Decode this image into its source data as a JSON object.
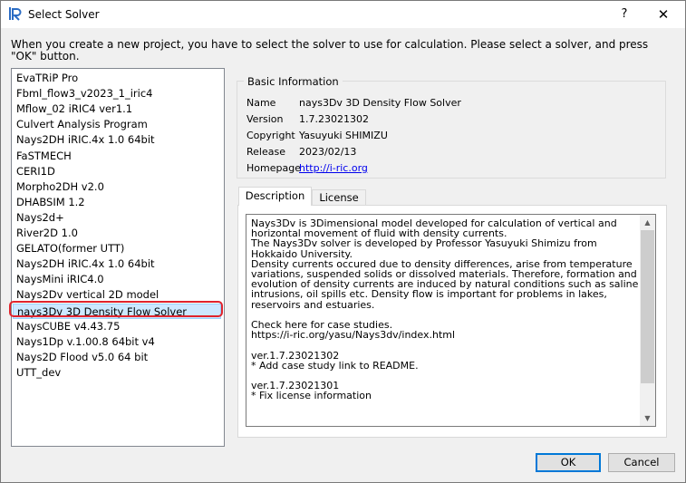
{
  "window": {
    "title": "Select Solver",
    "help_glyph": "?",
    "close_glyph": "✕"
  },
  "instruction": "When you create a new project, you have to select the solver to use for calculation. Please select a solver, and press \"OK\" button.",
  "solvers": [
    "EvaTRiP Pro",
    "Fbml_flow3_v2023_1_iric4",
    "Mflow_02 iRIC4 ver1.1",
    "Culvert Analysis Program",
    "Nays2DH iRIC.4x 1.0 64bit",
    "FaSTMECH",
    "CERI1D",
    "Morpho2DH v2.0",
    "DHABSIM 1.2",
    "Nays2d+",
    "River2D 1.0",
    "GELATO(former UTT)",
    "Nays2DH iRIC.4x 1.0 64bit",
    "NaysMini iRIC4.0",
    "Nays2Dv vertical 2D model",
    "nays3Dv 3D Density Flow Solver",
    "NaysCUBE v4.43.75",
    "Nays1Dp v.1.00.8 64bit v4",
    "Nays2D Flood v5.0 64 bit",
    "UTT_dev"
  ],
  "selected_solver": "nays3Dv 3D Density Flow Solver",
  "basic_info": {
    "title": "Basic Information",
    "name_label": "Name",
    "name_value": "nays3Dv 3D Density Flow Solver",
    "version_label": "Version",
    "version_value": "1.7.23021302",
    "copyright_label": "Copyright",
    "copyright_value": "Yasuyuki SHIMIZU",
    "release_label": "Release",
    "release_value": "2023/02/13",
    "homepage_label": "Homepage",
    "homepage_value": "http://i-ric.org"
  },
  "tabs": {
    "description": "Description",
    "license": "License"
  },
  "description_text": "Nays3Dv is 3Dimensional model developed for calculation of vertical and horizontal movement of fluid with density currents.\nThe Nays3Dv solver is developed by Professor Yasuyuki Shimizu from Hokkaido University.\nDensity currents occured due to density differences, arise from temperature variations, suspended solids or dissolved materials. Therefore, formation and evolution of density currents are induced by natural conditions such as saline intrusions, oil spills etc. Density flow is important for problems in lakes, reservoirs and estuaries.\n\nCheck here for case studies.\nhttps://i-ric.org/yasu/Nays3dv/index.html\n\nver.1.7.23021302\n* Add case study link to README.\n\nver.1.7.23021301\n* Fix license information",
  "buttons": {
    "ok": "OK",
    "cancel": "Cancel"
  },
  "colors": {
    "selection_bg": "#cce8ff",
    "highlight_ring": "#e0242c",
    "link": "#0000ee",
    "default_button_border": "#0078d7"
  }
}
